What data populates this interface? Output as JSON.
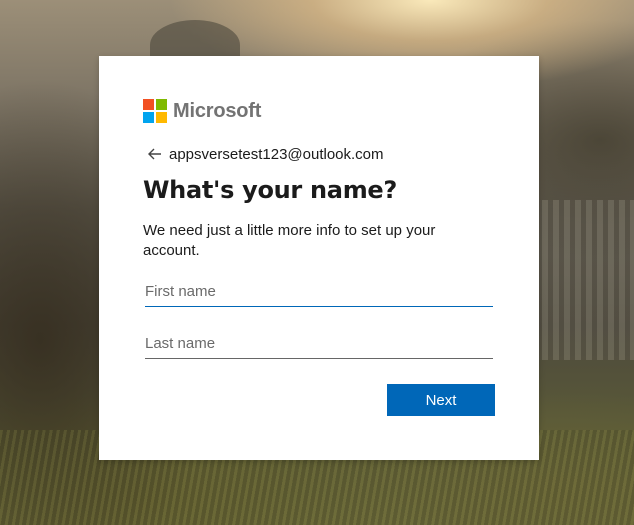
{
  "brand": {
    "name": "Microsoft",
    "logo_colors": [
      "#f25022",
      "#7fba00",
      "#00a4ef",
      "#ffb900"
    ]
  },
  "identity": {
    "back_icon": "arrow-left-icon",
    "email": "appsversetest123@outlook.com"
  },
  "form": {
    "title": "What's your name?",
    "description": "We need just a little more info to set up your account.",
    "first_name": {
      "placeholder": "First name",
      "value": ""
    },
    "last_name": {
      "placeholder": "Last name",
      "value": ""
    },
    "next_label": "Next"
  },
  "colors": {
    "accent": "#0067b8",
    "text": "#1b1b1b"
  }
}
